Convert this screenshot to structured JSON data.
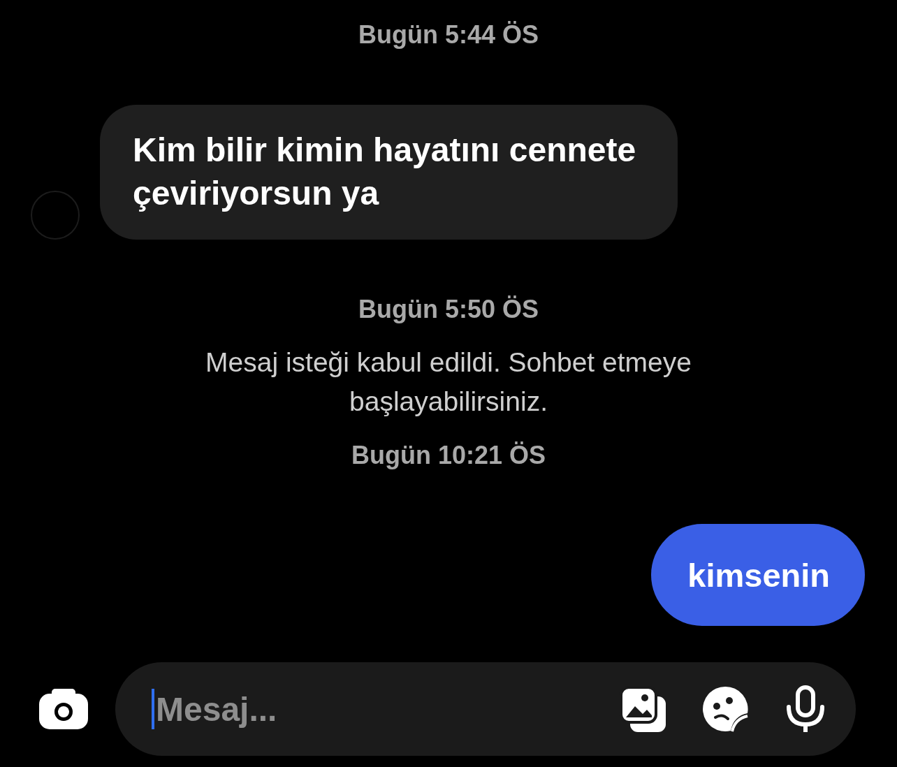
{
  "messages": [
    {
      "kind": "timestamp",
      "text": "Bugün 5:44 ÖS"
    },
    {
      "kind": "incoming",
      "text": "Kim bilir kimin hayatını cennete çeviriyorsun ya"
    },
    {
      "kind": "timestamp",
      "text": "Bugün 5:50 ÖS"
    },
    {
      "kind": "system",
      "text": "Mesaj isteği kabul edildi. Sohbet etmeye başlayabilirsiniz."
    },
    {
      "kind": "timestamp",
      "text": "Bugün 10:21 ÖS"
    },
    {
      "kind": "outgoing",
      "text": "kimsenin"
    }
  ],
  "composer": {
    "placeholder": "Mesaj...",
    "focused": true
  }
}
